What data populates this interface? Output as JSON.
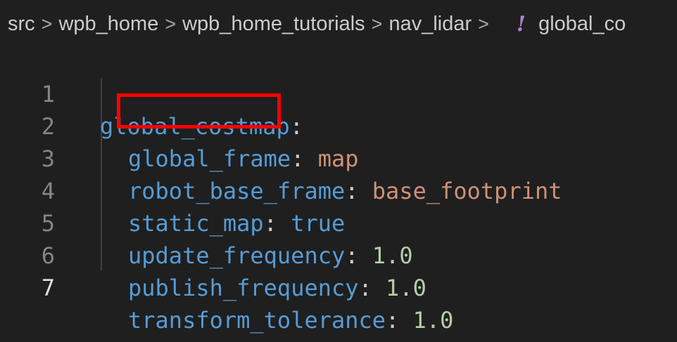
{
  "breadcrumb": {
    "items": [
      "src",
      "wpb_home",
      "wpb_home_tutorials",
      "nav_lidar"
    ],
    "separator": ">",
    "file_icon": "!",
    "file_name": "global_co"
  },
  "editor": {
    "lines": [
      {
        "number": "1",
        "key": "global_costmap",
        "colon": ":",
        "value": "",
        "value_type": "none",
        "indent": 0
      },
      {
        "number": "2",
        "key": "global_frame",
        "colon": ":",
        "value": "map",
        "value_type": "str",
        "indent": 1
      },
      {
        "number": "3",
        "key": "robot_base_frame",
        "colon": ":",
        "value": "base_footprint",
        "value_type": "str",
        "indent": 1
      },
      {
        "number": "4",
        "key": "static_map",
        "colon": ":",
        "value": "true",
        "value_type": "bool",
        "indent": 1
      },
      {
        "number": "5",
        "key": "update_frequency",
        "colon": ":",
        "value": "1.0",
        "value_type": "num",
        "indent": 1
      },
      {
        "number": "6",
        "key": "publish_frequency",
        "colon": ":",
        "value": "1.0",
        "value_type": "num",
        "indent": 1
      },
      {
        "number": "7",
        "key": "transform_tolerance",
        "colon": ":",
        "value": "1.0",
        "value_type": "num",
        "indent": 1
      }
    ],
    "active_line": "7"
  },
  "colors": {
    "background": "#1f1f1f",
    "key": "#569cd6",
    "string": "#ce9178",
    "number": "#b5cea8",
    "highlight_border": "#ff0000",
    "yaml_icon": "#b180d7"
  },
  "annotation": {
    "highlighted_key": "static_map"
  }
}
